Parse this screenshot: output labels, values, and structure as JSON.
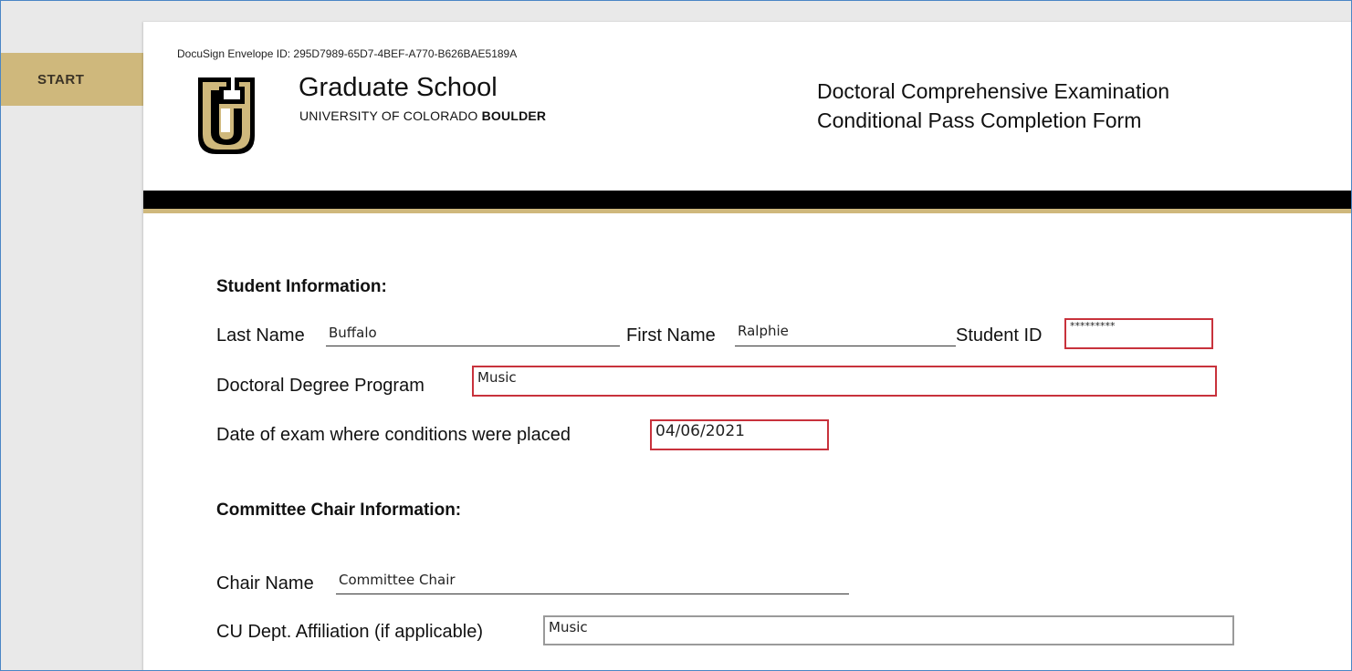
{
  "start_tab": {
    "label": "START"
  },
  "header": {
    "envelope_id": "DocuSign Envelope ID: 295D7989-65D7-4BEF-A770-B626BAE5189A",
    "school_title": "Graduate School",
    "university_prefix": "UNIVERSITY OF COLORADO ",
    "university_bold": "BOULDER",
    "form_title_line1": "Doctoral Comprehensive Examination",
    "form_title_line2": "Conditional Pass Completion Form"
  },
  "colors": {
    "gold": "#cfb87c",
    "required_border": "#c8323c",
    "optional_border": "#9a9a9a",
    "frame": "#4a86c5"
  },
  "student": {
    "section_title": "Student Information:",
    "last_name_label": "Last Name",
    "last_name_value": "Buffalo",
    "first_name_label": "First Name",
    "first_name_value": "Ralphie",
    "student_id_label": "Student ID",
    "student_id_value": "*********",
    "program_label": "Doctoral Degree Program",
    "program_value": "Music",
    "exam_date_label": "Date of exam where conditions were placed",
    "exam_date_value": "04/06/2021"
  },
  "chair": {
    "section_title": "Committee Chair Information:",
    "name_label": "Chair Name",
    "name_value": "Committee Chair",
    "dept_label": "CU Dept. Affiliation (if applicable)",
    "dept_value": "Music"
  }
}
